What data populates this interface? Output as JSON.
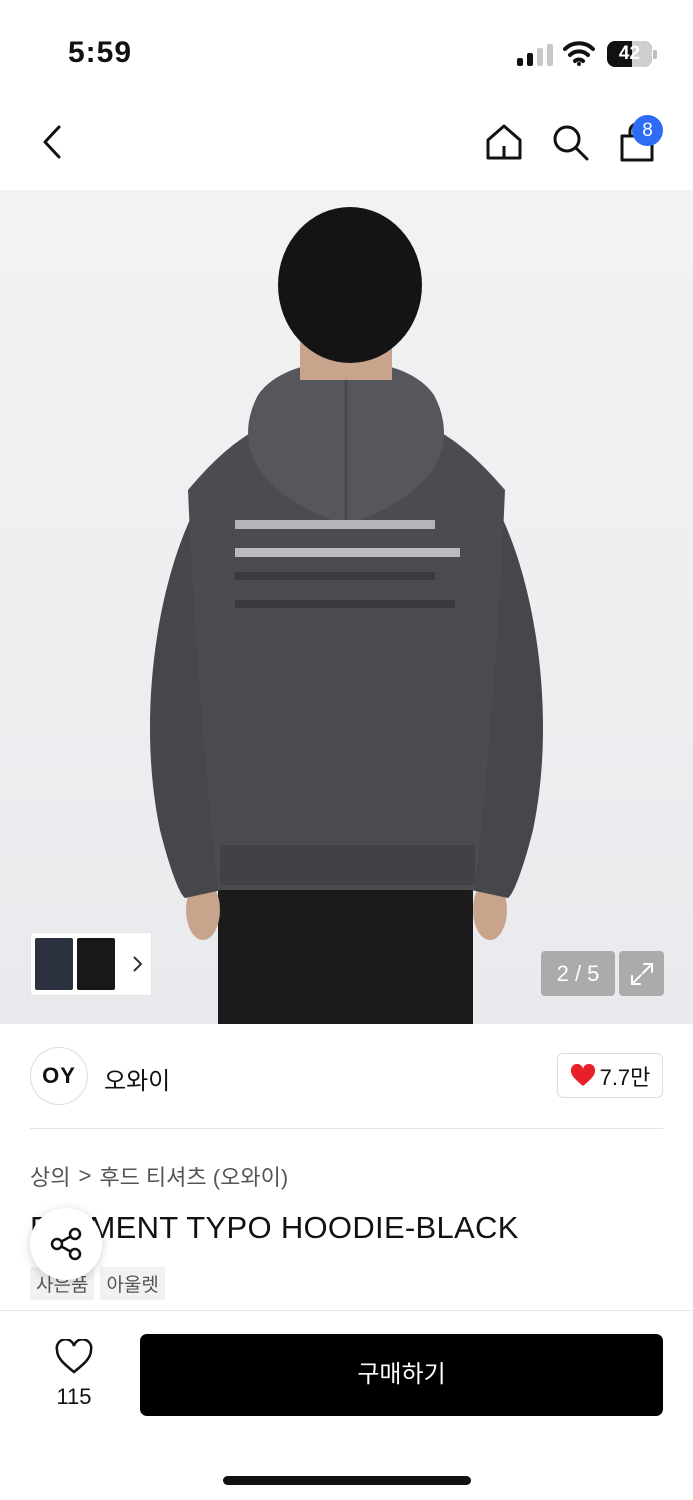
{
  "status": {
    "time": "5:59",
    "battery": "42"
  },
  "nav": {
    "cart_count": "8"
  },
  "gallery": {
    "counter": "2 / 5"
  },
  "brand": {
    "logo": "OY",
    "name": "오와이",
    "likes": "7.7만"
  },
  "breadcrumb": {
    "category": "상의",
    "separator": ">",
    "subcategory": "후드 티셔츠 (오와이)"
  },
  "product": {
    "title": "ELEMENT TYPO HOODIE-BLACK",
    "tags": [
      "사은품",
      "아울렛"
    ]
  },
  "bottom": {
    "wish_count": "115",
    "buy_label": "구매하기"
  },
  "colors": {
    "badge": "#2f6cf6",
    "heart": "#e8202a",
    "buy_button": "#000000"
  },
  "icons": [
    "back-icon",
    "home-icon",
    "search-icon",
    "cart-icon",
    "chevron-right-icon",
    "expand-icon",
    "heart-icon",
    "share-icon"
  ]
}
